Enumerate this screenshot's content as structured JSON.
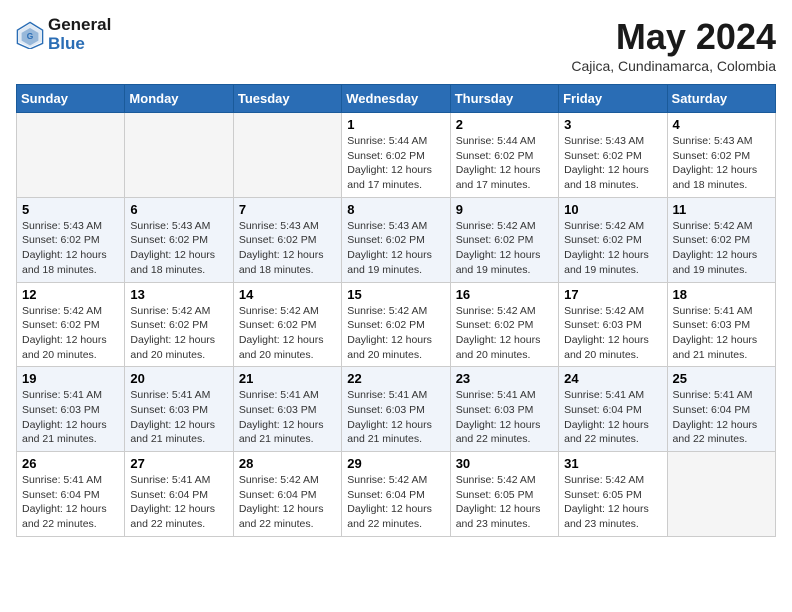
{
  "logo": {
    "line1": "General",
    "line2": "Blue"
  },
  "title": "May 2024",
  "subtitle": "Cajica, Cundinamarca, Colombia",
  "weekdays": [
    "Sunday",
    "Monday",
    "Tuesday",
    "Wednesday",
    "Thursday",
    "Friday",
    "Saturday"
  ],
  "weeks": [
    [
      {
        "day": "",
        "info": ""
      },
      {
        "day": "",
        "info": ""
      },
      {
        "day": "",
        "info": ""
      },
      {
        "day": "1",
        "info": "Sunrise: 5:44 AM\nSunset: 6:02 PM\nDaylight: 12 hours\nand 17 minutes."
      },
      {
        "day": "2",
        "info": "Sunrise: 5:44 AM\nSunset: 6:02 PM\nDaylight: 12 hours\nand 17 minutes."
      },
      {
        "day": "3",
        "info": "Sunrise: 5:43 AM\nSunset: 6:02 PM\nDaylight: 12 hours\nand 18 minutes."
      },
      {
        "day": "4",
        "info": "Sunrise: 5:43 AM\nSunset: 6:02 PM\nDaylight: 12 hours\nand 18 minutes."
      }
    ],
    [
      {
        "day": "5",
        "info": "Sunrise: 5:43 AM\nSunset: 6:02 PM\nDaylight: 12 hours\nand 18 minutes."
      },
      {
        "day": "6",
        "info": "Sunrise: 5:43 AM\nSunset: 6:02 PM\nDaylight: 12 hours\nand 18 minutes."
      },
      {
        "day": "7",
        "info": "Sunrise: 5:43 AM\nSunset: 6:02 PM\nDaylight: 12 hours\nand 18 minutes."
      },
      {
        "day": "8",
        "info": "Sunrise: 5:43 AM\nSunset: 6:02 PM\nDaylight: 12 hours\nand 19 minutes."
      },
      {
        "day": "9",
        "info": "Sunrise: 5:42 AM\nSunset: 6:02 PM\nDaylight: 12 hours\nand 19 minutes."
      },
      {
        "day": "10",
        "info": "Sunrise: 5:42 AM\nSunset: 6:02 PM\nDaylight: 12 hours\nand 19 minutes."
      },
      {
        "day": "11",
        "info": "Sunrise: 5:42 AM\nSunset: 6:02 PM\nDaylight: 12 hours\nand 19 minutes."
      }
    ],
    [
      {
        "day": "12",
        "info": "Sunrise: 5:42 AM\nSunset: 6:02 PM\nDaylight: 12 hours\nand 20 minutes."
      },
      {
        "day": "13",
        "info": "Sunrise: 5:42 AM\nSunset: 6:02 PM\nDaylight: 12 hours\nand 20 minutes."
      },
      {
        "day": "14",
        "info": "Sunrise: 5:42 AM\nSunset: 6:02 PM\nDaylight: 12 hours\nand 20 minutes."
      },
      {
        "day": "15",
        "info": "Sunrise: 5:42 AM\nSunset: 6:02 PM\nDaylight: 12 hours\nand 20 minutes."
      },
      {
        "day": "16",
        "info": "Sunrise: 5:42 AM\nSunset: 6:02 PM\nDaylight: 12 hours\nand 20 minutes."
      },
      {
        "day": "17",
        "info": "Sunrise: 5:42 AM\nSunset: 6:03 PM\nDaylight: 12 hours\nand 20 minutes."
      },
      {
        "day": "18",
        "info": "Sunrise: 5:41 AM\nSunset: 6:03 PM\nDaylight: 12 hours\nand 21 minutes."
      }
    ],
    [
      {
        "day": "19",
        "info": "Sunrise: 5:41 AM\nSunset: 6:03 PM\nDaylight: 12 hours\nand 21 minutes."
      },
      {
        "day": "20",
        "info": "Sunrise: 5:41 AM\nSunset: 6:03 PM\nDaylight: 12 hours\nand 21 minutes."
      },
      {
        "day": "21",
        "info": "Sunrise: 5:41 AM\nSunset: 6:03 PM\nDaylight: 12 hours\nand 21 minutes."
      },
      {
        "day": "22",
        "info": "Sunrise: 5:41 AM\nSunset: 6:03 PM\nDaylight: 12 hours\nand 21 minutes."
      },
      {
        "day": "23",
        "info": "Sunrise: 5:41 AM\nSunset: 6:03 PM\nDaylight: 12 hours\nand 22 minutes."
      },
      {
        "day": "24",
        "info": "Sunrise: 5:41 AM\nSunset: 6:04 PM\nDaylight: 12 hours\nand 22 minutes."
      },
      {
        "day": "25",
        "info": "Sunrise: 5:41 AM\nSunset: 6:04 PM\nDaylight: 12 hours\nand 22 minutes."
      }
    ],
    [
      {
        "day": "26",
        "info": "Sunrise: 5:41 AM\nSunset: 6:04 PM\nDaylight: 12 hours\nand 22 minutes."
      },
      {
        "day": "27",
        "info": "Sunrise: 5:41 AM\nSunset: 6:04 PM\nDaylight: 12 hours\nand 22 minutes."
      },
      {
        "day": "28",
        "info": "Sunrise: 5:42 AM\nSunset: 6:04 PM\nDaylight: 12 hours\nand 22 minutes."
      },
      {
        "day": "29",
        "info": "Sunrise: 5:42 AM\nSunset: 6:04 PM\nDaylight: 12 hours\nand 22 minutes."
      },
      {
        "day": "30",
        "info": "Sunrise: 5:42 AM\nSunset: 6:05 PM\nDaylight: 12 hours\nand 23 minutes."
      },
      {
        "day": "31",
        "info": "Sunrise: 5:42 AM\nSunset: 6:05 PM\nDaylight: 12 hours\nand 23 minutes."
      },
      {
        "day": "",
        "info": ""
      }
    ]
  ]
}
